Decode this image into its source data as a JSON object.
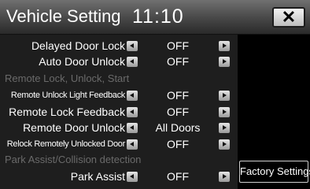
{
  "header": {
    "title": "Vehicle Setting",
    "clock": "11:10",
    "close_icon": "close-icon",
    "close_label": "✕"
  },
  "settings": [
    {
      "label": "Delayed Door Lock",
      "value": "OFF"
    },
    {
      "label": "Auto Door Unlock",
      "value": "OFF"
    },
    {
      "section": "Remote Lock, Unlock, Start"
    },
    {
      "label": "Remote Unlock Light Feedback",
      "value": "OFF"
    },
    {
      "label": "Remote Lock Feedback",
      "value": "OFF"
    },
    {
      "label": "Remote Door Unlock",
      "value": "All Doors"
    },
    {
      "label": "Relock Remotely Unlocked Door",
      "value": "OFF"
    },
    {
      "section": "Park Assist/Collision detection"
    },
    {
      "label": "Park Assist",
      "value": "OFF"
    }
  ],
  "factory_button": {
    "label": "Factory Settings"
  },
  "colors": {
    "background": "#000000",
    "list_background": "#1e1e1e",
    "section_text": "#6a6a6a",
    "text": "#ffffff"
  }
}
